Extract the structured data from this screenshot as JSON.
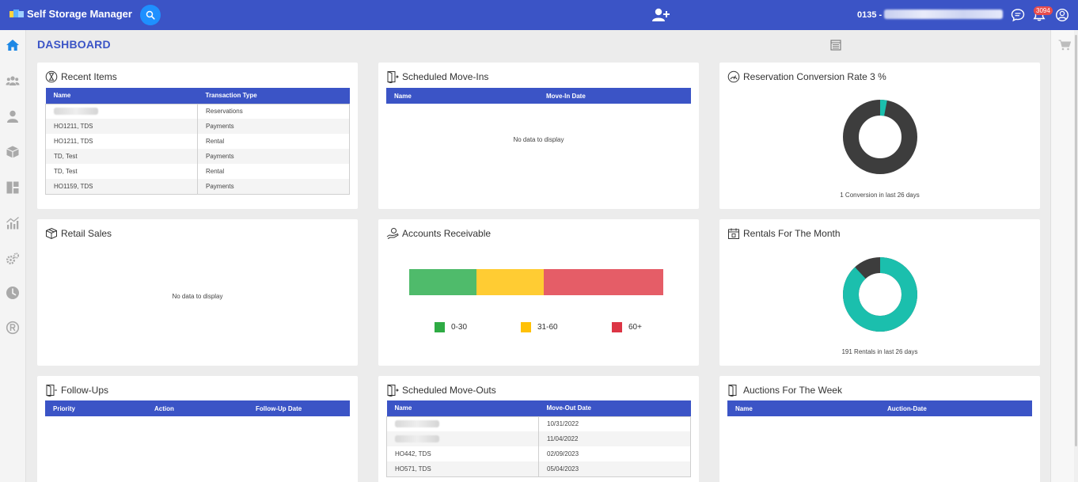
{
  "app": {
    "title": "Self Storage Manager",
    "account_prefix": "0135 -",
    "notification_count": "3094"
  },
  "colors": {
    "header": "#3b54c6",
    "accent_teal": "#1bbfad",
    "dark_gray": "#3d3d3d",
    "ar_green": "#4fbb6b",
    "ar_yellow": "#ffcc33",
    "ar_red": "#e55d67",
    "legend_green": "#2eab44",
    "legend_yellow": "#ffc107",
    "legend_red": "#dc3545"
  },
  "sidebar_icons": [
    "home-icon",
    "users-icon",
    "user-icon",
    "box-icon",
    "layout-icon",
    "reports-icon",
    "settings-icon",
    "clock-icon",
    "registered-icon"
  ],
  "page": {
    "title": "DASHBOARD"
  },
  "recent_items": {
    "title": "Recent Items",
    "columns": [
      "Name",
      "Transaction Type"
    ],
    "rows": [
      {
        "name": "",
        "type": "Reservations"
      },
      {
        "name": "HO1211, TDS",
        "type": "Payments"
      },
      {
        "name": "HO1211, TDS",
        "type": "Rental"
      },
      {
        "name": "TD, Test",
        "type": "Payments"
      },
      {
        "name": "TD, Test",
        "type": "Rental"
      },
      {
        "name": "HO1159, TDS",
        "type": "Payments"
      }
    ]
  },
  "scheduled_move_ins": {
    "title": "Scheduled Move-Ins",
    "columns": [
      "Name",
      "Move-In Date"
    ],
    "empty_text": "No data to display"
  },
  "reservation_conversion": {
    "title": "Reservation Conversion Rate 3 %",
    "rate_percent": 3,
    "caption": "1 Conversion in last 26 days"
  },
  "retail_sales": {
    "title": "Retail Sales",
    "empty_text": "No data to display"
  },
  "accounts_receivable": {
    "title": "Accounts Receivable",
    "segments": [
      {
        "label": "0-30",
        "share": 0.265
      },
      {
        "label": "31-60",
        "share": 0.265
      },
      {
        "label": "60+",
        "share": 0.47
      }
    ]
  },
  "rentals_month": {
    "title": "Rentals For The Month",
    "teal_share": 0.88,
    "caption": "191 Rentals in last 26 days"
  },
  "follow_ups": {
    "title": "Follow-Ups",
    "columns": [
      "Priority",
      "Action",
      "Follow-Up Date"
    ]
  },
  "scheduled_move_outs": {
    "title": "Scheduled Move-Outs",
    "columns": [
      "Name",
      "Move-Out Date"
    ],
    "rows": [
      {
        "name": "",
        "date": "10/31/2022"
      },
      {
        "name": "",
        "date": "11/04/2022"
      },
      {
        "name": "HO442, TDS",
        "date": "02/09/2023"
      },
      {
        "name": "HO571, TDS",
        "date": "05/04/2023"
      }
    ]
  },
  "auctions_week": {
    "title": "Auctions For The Week",
    "columns": [
      "Name",
      "Auction-Date"
    ]
  }
}
